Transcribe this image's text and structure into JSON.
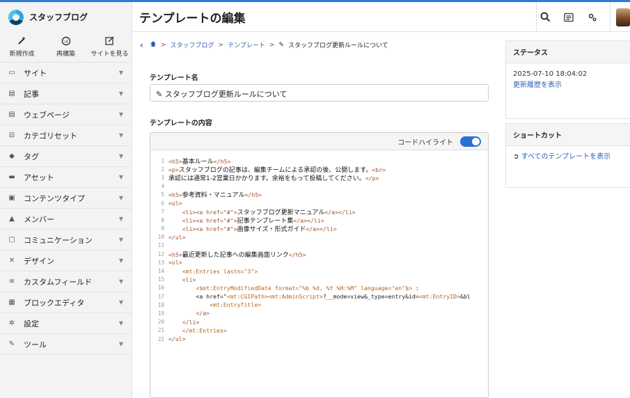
{
  "app": {
    "name": "スタッフブログ"
  },
  "page": {
    "title": "テンプレートの編集"
  },
  "header": {
    "icons": [
      "search-icon",
      "list-icon",
      "gear-icon",
      "avatar"
    ]
  },
  "quick_actions": [
    {
      "icon": "new-entry-icon",
      "label": "新規作成"
    },
    {
      "icon": "rebuild-icon",
      "label": "再構築"
    },
    {
      "icon": "view-site-icon",
      "label": "サイトを見る"
    }
  ],
  "sidebar": {
    "items": [
      {
        "icon": "site-icon",
        "label": "サイト"
      },
      {
        "icon": "entry-icon",
        "label": "記事"
      },
      {
        "icon": "webpage-icon",
        "label": "ウェブページ"
      },
      {
        "icon": "category-set-icon",
        "label": "カテゴリセット"
      },
      {
        "icon": "tag-icon",
        "label": "タグ"
      },
      {
        "icon": "asset-icon",
        "label": "アセット"
      },
      {
        "icon": "content-type-icon",
        "label": "コンテンツタイプ"
      },
      {
        "icon": "member-icon",
        "label": "メンバー"
      },
      {
        "icon": "communication-icon",
        "label": "コミュニケーション"
      },
      {
        "icon": "design-icon",
        "label": "デザイン"
      },
      {
        "icon": "custom-field-icon",
        "label": "カスタムフィールド"
      },
      {
        "icon": "block-editor-icon",
        "label": "ブロックエディタ"
      },
      {
        "icon": "settings-icon",
        "label": "設定"
      },
      {
        "icon": "tools-icon",
        "label": "ツール"
      }
    ]
  },
  "breadcrumb": [
    "スタッフブログ",
    "テンプレート",
    "スタッフブログ更新ルールについて"
  ],
  "form": {
    "template_name_label": "テンプレート名",
    "template_name_value": "スタッフブログ更新ルールについて",
    "content_label": "テンプレートの内容",
    "code_highlight_label": "コードハイライト",
    "code_highlight_on": true
  },
  "code_lines": [
    "<h5>基本ルール</h5>",
    "<p>スタッフブログの記事は、編集チームによる承認の後、公開します。<br>",
    "承認には通常1-2営業日かかります。余裕をもって投稿してください。</p>",
    "",
    "<h5>参考資料・マニュアル</h5>",
    "<ul>",
    "    <li><a href=\"#\">スタッフブログ更新マニュアル</a></li>",
    "    <li><a href=\"#\">記事テンプレート集</a></li>",
    "    <li><a href=\"#\">画像サイズ・形式ガイド</a></li>",
    "</ul>",
    "",
    "<h5>最近更新した記事への編集画面リンク</h5>",
    "<ul>",
    "    <mt:Entries lastn=\"3\">",
    "    <li>",
    "        <$mt:EntryModifiedDate format=\"%b %d, %Y %H:%M\" language=\"en\"$> :",
    "        <a href=\"<mt:CGIPath><mt:AdminScript>?__mode=view&_type=entry&id=<mt:EntryID>&bl",
    "            <mt:EntryTitle>",
    "        </a>",
    "    </li>",
    "    </mt:Entries>",
    "</ul>"
  ],
  "status": {
    "title": "ステータス",
    "datetime": "2025-07-10 18:04:02",
    "history_link": "更新履歴を表示"
  },
  "shortcut": {
    "title": "ショートカット",
    "link": "すべてのテンプレートを表示"
  },
  "colors": {
    "accent": "#2e7bd6",
    "link": "#2a5fb0",
    "toggle": "#2a6fd6"
  }
}
